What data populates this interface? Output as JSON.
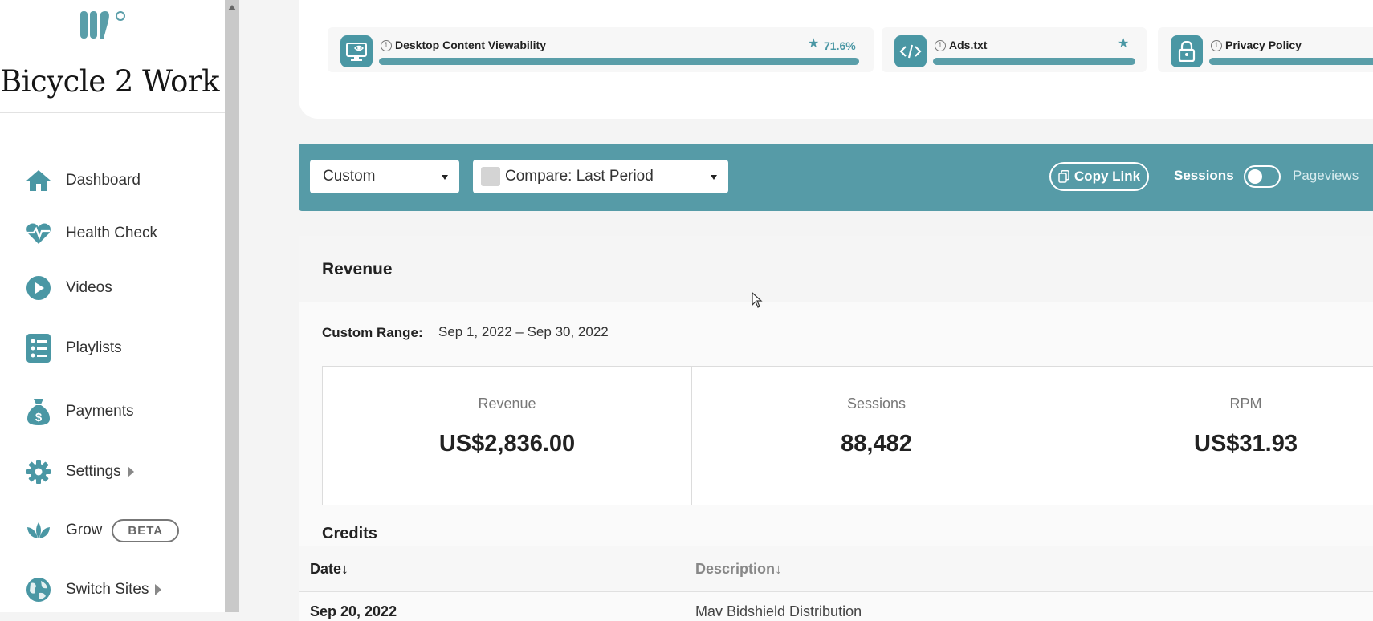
{
  "sidebar": {
    "site_title": "Bicycle 2 Work",
    "items": [
      {
        "label": "Dashboard",
        "icon": "home-icon"
      },
      {
        "label": "Health Check",
        "icon": "heartbeat-icon"
      },
      {
        "label": "Videos",
        "icon": "play-icon"
      },
      {
        "label": "Playlists",
        "icon": "list-icon"
      },
      {
        "label": "Payments",
        "icon": "money-bag-icon"
      },
      {
        "label": "Settings",
        "icon": "gear-icon"
      },
      {
        "label": "Grow",
        "icon": "leaf-icon",
        "badge": "BETA"
      },
      {
        "label": "Switch Sites",
        "icon": "globe-icon"
      }
    ]
  },
  "health": {
    "tiles": [
      {
        "label": "Desktop Content Viewability",
        "value": "71.6%",
        "icon": "monitor-eye-icon"
      },
      {
        "label": "Ads.txt",
        "icon": "code-icon"
      },
      {
        "label": "Privacy Policy",
        "icon": "lock-icon"
      }
    ]
  },
  "filters": {
    "range_select": "Custom",
    "compare_select": "Compare: Last Period",
    "copy_link": "Copy Link",
    "toggle_on_label": "Sessions",
    "toggle_off_label": "Pageviews"
  },
  "revenue": {
    "title": "Revenue",
    "range_label": "Custom Range:",
    "range_value": "Sep 1, 2022 – Sep 30, 2022",
    "stats": [
      {
        "title": "Revenue",
        "value": "US$2,836.00"
      },
      {
        "title": "Sessions",
        "value": "88,482"
      },
      {
        "title": "RPM",
        "value": "US$31.93"
      }
    ]
  },
  "credits": {
    "title": "Credits",
    "columns": [
      "Date",
      "Description"
    ],
    "rows": [
      {
        "date": "Sep 20, 2022",
        "description": "Mav Bidshield Distribution"
      }
    ]
  },
  "colors": {
    "accent": "#569ba7",
    "icon": "#4a97a4"
  }
}
